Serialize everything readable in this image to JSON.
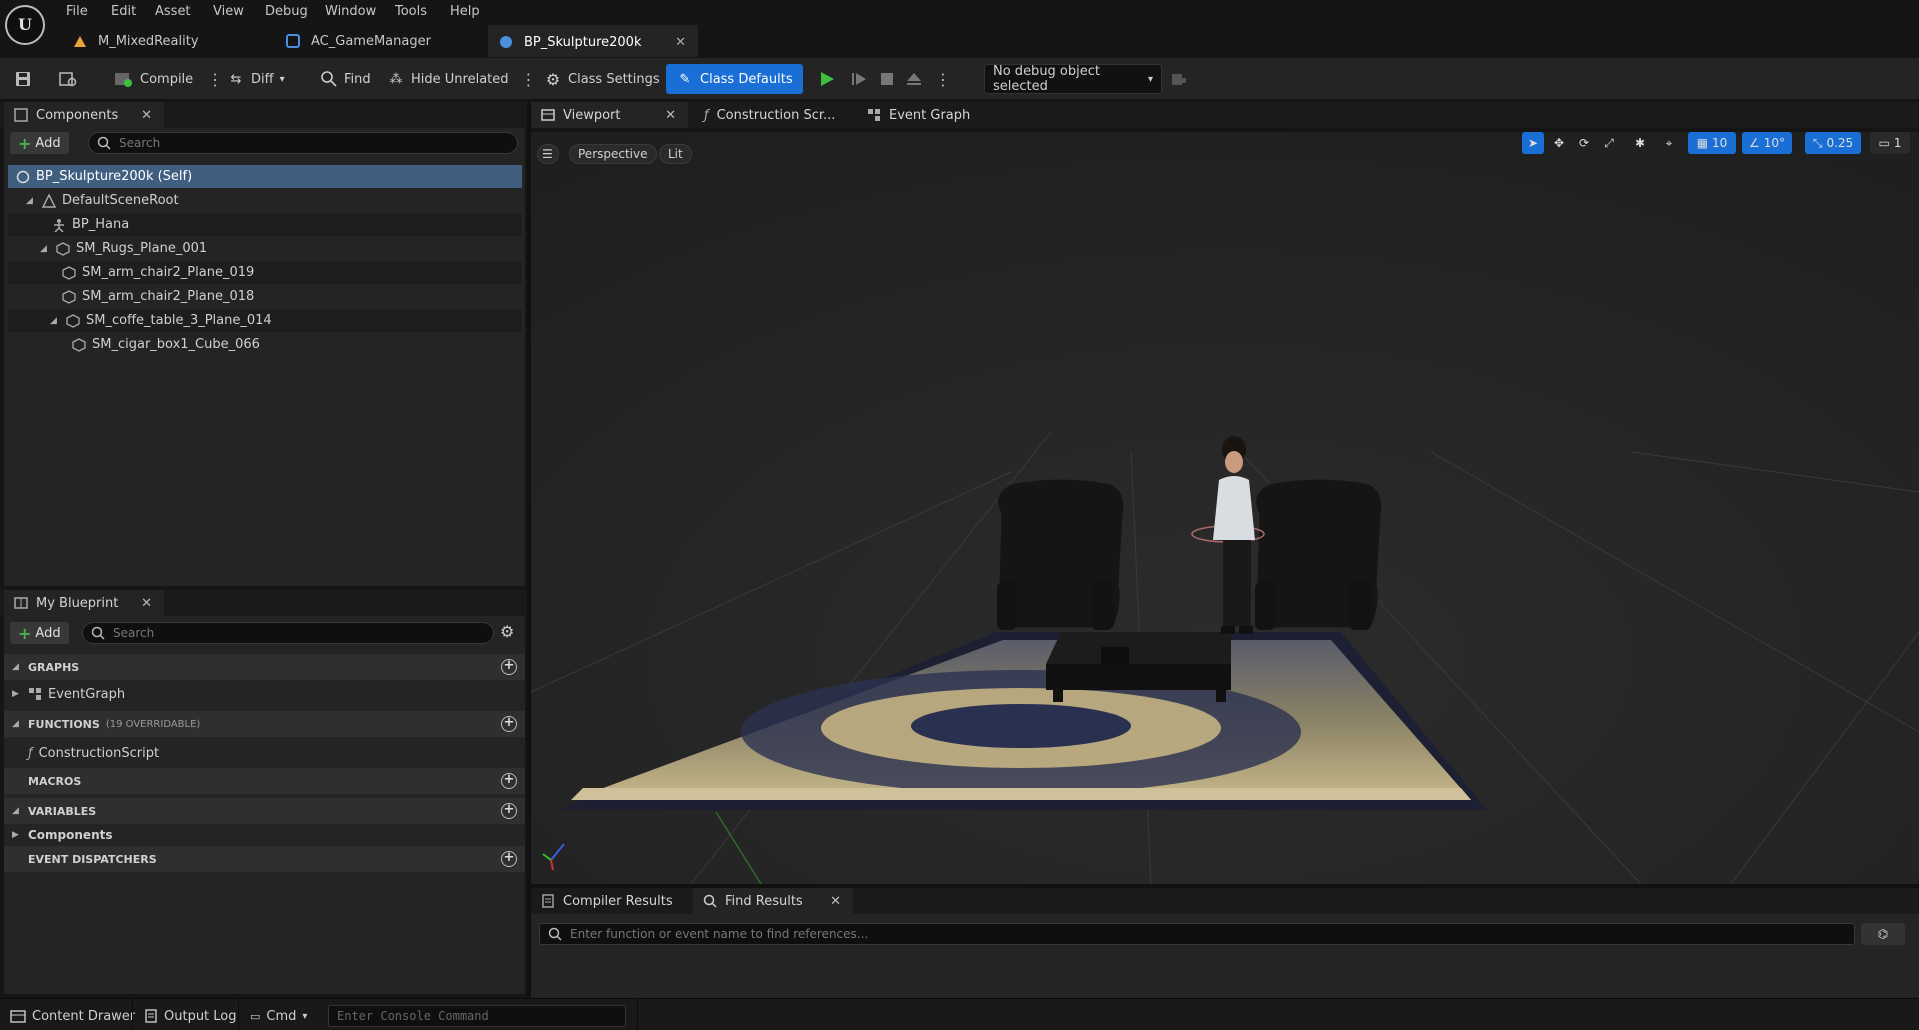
{
  "menu": [
    "File",
    "Edit",
    "Asset",
    "View",
    "Debug",
    "Window",
    "Tools",
    "Help"
  ],
  "logo_text": "U",
  "doc_tabs": [
    {
      "label": "M_MixedReality",
      "icon": "material-icon"
    },
    {
      "label": "AC_GameManager",
      "icon": "component-class-icon"
    },
    {
      "label": "BP_Skulpture200k",
      "icon": "blueprint-icon",
      "active": true
    }
  ],
  "toolbar": {
    "compile": "Compile",
    "diff": "Diff",
    "find": "Find",
    "hide_unrelated": "Hide Unrelated",
    "class_settings": "Class Settings",
    "class_defaults": "Class Defaults",
    "debug_object": "No debug object selected"
  },
  "components_panel": {
    "title": "Components",
    "add": "Add",
    "search_placeholder": "Search",
    "tree": [
      {
        "label": "BP_Skulpture200k (Self)",
        "depth": 0,
        "selected": true
      },
      {
        "label": "DefaultSceneRoot",
        "depth": 1,
        "expanded": true
      },
      {
        "label": "BP_Hana",
        "depth": 2
      },
      {
        "label": "SM_Rugs_Plane_001",
        "depth": 2,
        "expanded": true
      },
      {
        "label": "SM_arm_chair2_Plane_019",
        "depth": 3
      },
      {
        "label": "SM_arm_chair2_Plane_018",
        "depth": 3
      },
      {
        "label": "SM_coffe_table_3_Plane_014",
        "depth": 3,
        "expanded": true
      },
      {
        "label": "SM_cigar_box1_Cube_066",
        "depth": 4
      }
    ]
  },
  "my_blueprint": {
    "title": "My Blueprint",
    "add": "Add",
    "search_placeholder": "Search",
    "graphs": "GRAPHS",
    "event_graph": "EventGraph",
    "functions": "FUNCTIONS",
    "functions_sub": "(19 OVERRIDABLE)",
    "construction_script": "ConstructionScript",
    "macros": "MACROS",
    "variables": "VARIABLES",
    "components": "Components",
    "event_dispatchers": "EVENT DISPATCHERS"
  },
  "editor_tabs": {
    "viewport": "Viewport",
    "construction": "Construction Scr...",
    "event_graph": "Event Graph"
  },
  "viewport_bar": {
    "perspective": "Perspective",
    "lit": "Lit",
    "grid_snap": "10",
    "rot_snap": "10°",
    "scale_snap": "0.25",
    "camera_speed": "1"
  },
  "bottom_tabs": {
    "compiler_results": "Compiler Results",
    "find_results": "Find Results",
    "find_placeholder": "Enter function or event name to find references..."
  },
  "statusbar": {
    "content_drawer": "Content Drawer",
    "output_log": "Output Log",
    "cmd": "Cmd",
    "console_placeholder": "Enter Console Command"
  },
  "colors": {
    "accent_blue": "#1a6fd6",
    "selection": "#3f5e80",
    "play_green": "#3fbf3f"
  }
}
